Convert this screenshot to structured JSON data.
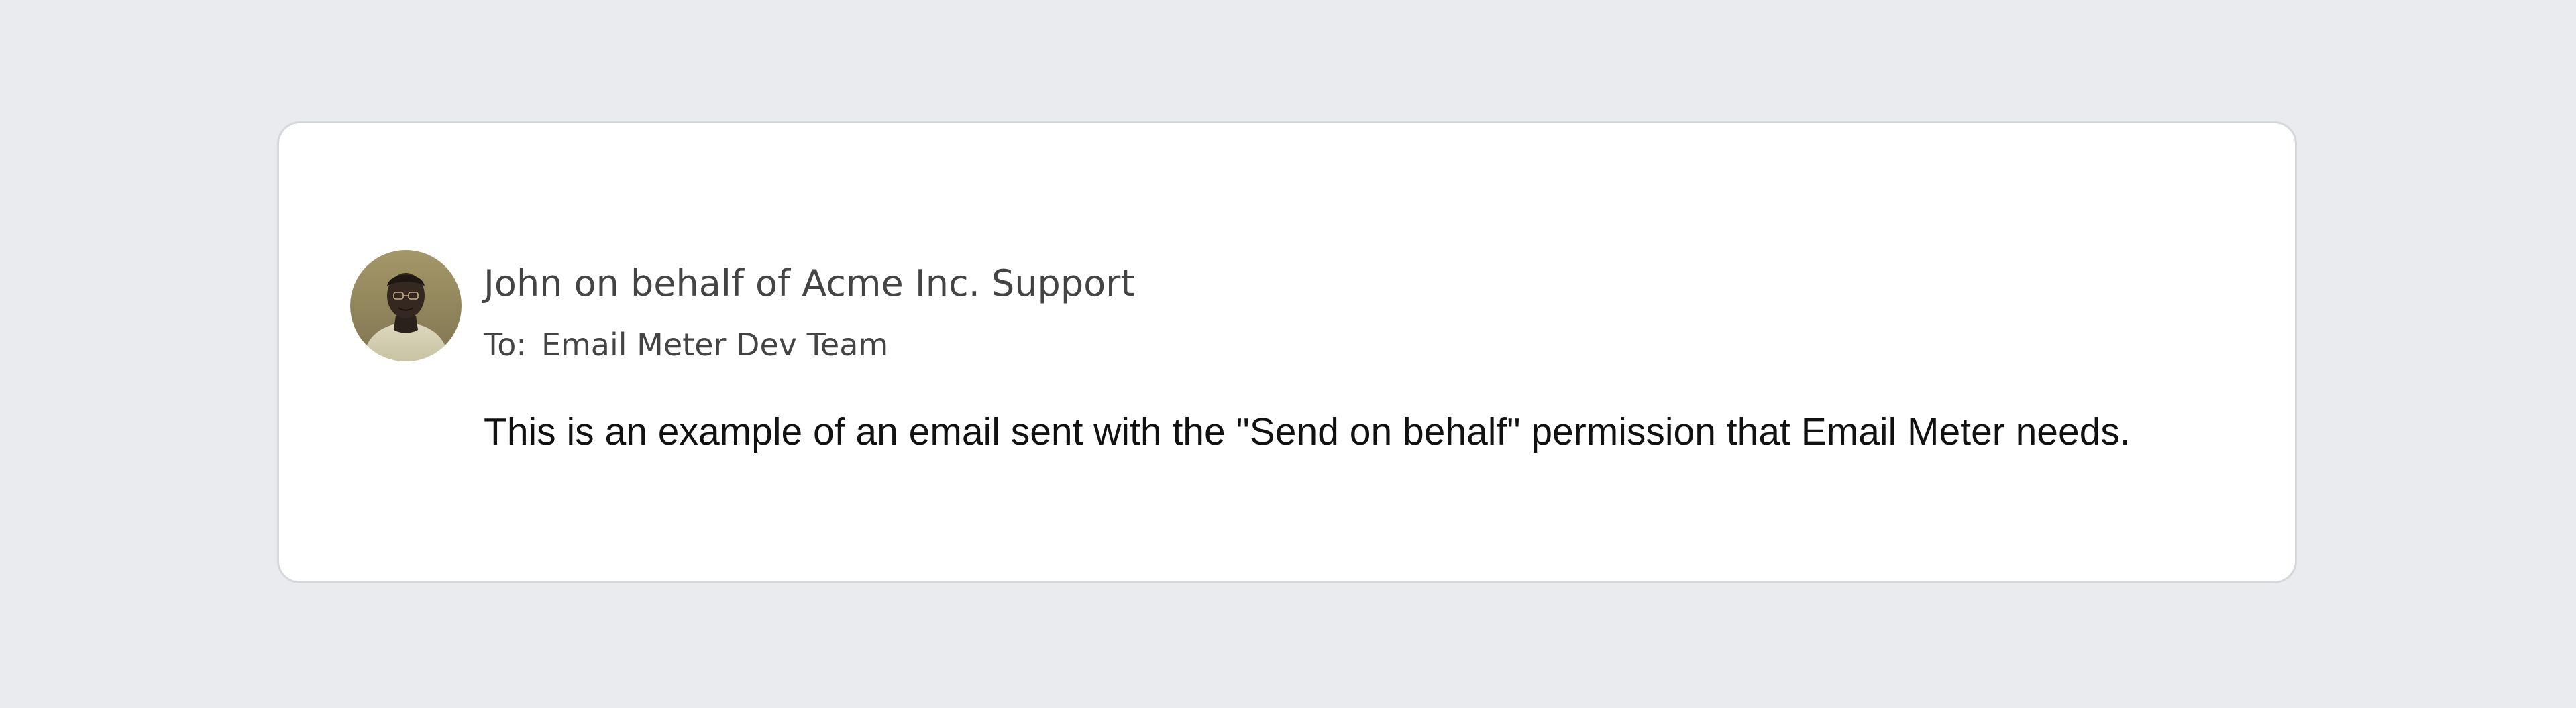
{
  "message": {
    "sender_line": "John on behalf of Acme Inc. Support",
    "to_label": "To:",
    "recipient": "Email Meter Dev Team",
    "body": "This is an example of an email sent with the \"Send on behalf\" permission that Email Meter needs."
  },
  "colors": {
    "page_background": "#e9ebef",
    "card_background": "#ffffff",
    "card_border": "#d4d7dc",
    "header_text": "#444444",
    "body_text": "#111111"
  },
  "icons": {
    "avatar": "person-avatar"
  }
}
